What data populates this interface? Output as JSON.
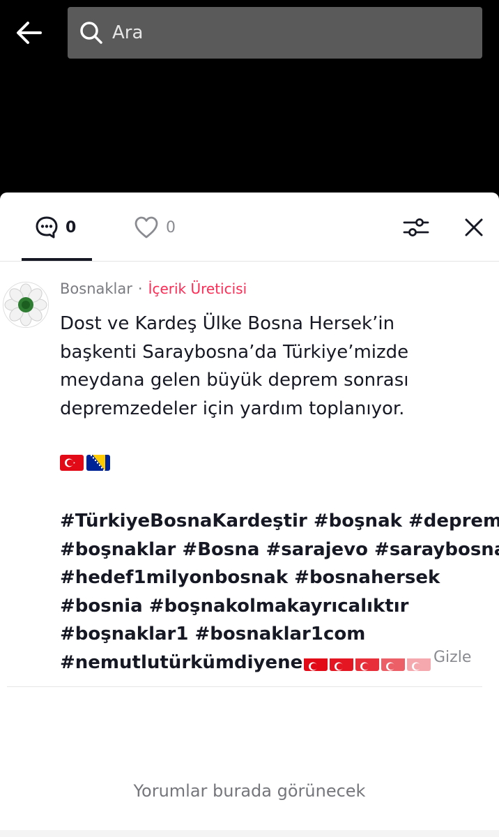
{
  "header": {
    "back_icon": "arrow-left-icon",
    "search_icon": "search-icon",
    "search_placeholder": "Ara"
  },
  "tabs": {
    "comments": {
      "icon": "comment-bubble-icon",
      "count": "0"
    },
    "likes": {
      "icon": "heart-icon",
      "count": "0"
    }
  },
  "toolbar": {
    "filter_icon": "sliders-icon",
    "close_icon": "close-icon"
  },
  "post": {
    "author": "Bosnaklar",
    "separator": "·",
    "badge": "İçerik Üreticisi",
    "lines": [
      "Dost ve Kardeş Ülke Bosna Hersek’in",
      "başkenti Saraybosna’da Türkiye’mizde",
      "meydana gelen büyük deprem sonrası",
      "depremzedeler için yardım toplanıyor."
    ],
    "flags": [
      "turkey-flag-emoji",
      "bosnia-flag-emoji"
    ],
    "hashtag_lines": [
      "#TürkiyeBosnaKardeştir #boşnak #deprem",
      "#boşnaklar #Bosna #sarajevo #saraybosna",
      "#hedef1milyonbosnak #bosnahersek",
      "#bosnia #boşnakolmakayrıcalıktır",
      "#boşnaklar1 #bosnaklar1com",
      "#nemutlutürkümdiyene"
    ],
    "trailing_flags": [
      "turkey-flag-emoji",
      "turkey-flag-emoji",
      "turkey-flag-emoji",
      "turkey-flag-emoji",
      "turkey-flag-emoji"
    ],
    "hide_label": "Gizle"
  },
  "empty_state": "Yorumlar burada görünecek",
  "colors": {
    "accent": "#fe2c55",
    "text": "#161823",
    "muted": "#8a8b91",
    "search_bg": "#5a5a5a"
  }
}
